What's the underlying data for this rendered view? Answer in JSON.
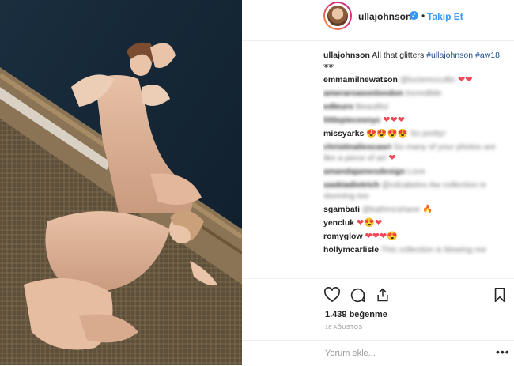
{
  "header": {
    "username": "ullajohnson",
    "verified_icon": "verified-badge-icon",
    "separator": "•",
    "follow_label": "Takip Et"
  },
  "caption": {
    "username": "ullajohnson",
    "text": "All that glitters",
    "hashtag1": "#ullajohnson",
    "hashtag2": "#aw18",
    "emoji": "🕶"
  },
  "comments": [
    {
      "user": "emmamilnewatson",
      "mention": "@luciemccullin",
      "text": "",
      "emoji": "❤❤"
    },
    {
      "user": "ameraroasonlondon",
      "mention": "",
      "text": "Incredible",
      "emoji": ""
    },
    {
      "user": "edleuro",
      "mention": "",
      "text": "Beautiful",
      "emoji": ""
    },
    {
      "user": "littlepiecesnyc",
      "mention": "",
      "text": "",
      "emoji": "❤❤❤"
    },
    {
      "user": "missyarks",
      "mention": "",
      "text": "So pretty!",
      "emoji": "😍😍😍😍"
    },
    {
      "user": "christinaliescasri",
      "mention": "",
      "text": "So many of your photos are like a piece of art",
      "emoji": "❤"
    },
    {
      "user": "amandajamesdesign",
      "mention": "",
      "text": "Love",
      "emoji": ""
    },
    {
      "user": "saskiadiotrich",
      "mention": "@cdcabelvo",
      "text": "Aw collection is stunning too",
      "emoji": ""
    },
    {
      "user": "sgambati",
      "mention": "@kathmcshane",
      "text": "",
      "emoji": "🔥"
    },
    {
      "user": "yencluk",
      "mention": "",
      "text": "",
      "emoji": "❤😍❤"
    },
    {
      "user": "romyglow",
      "mention": "",
      "text": "",
      "emoji": "❤❤❤😍"
    },
    {
      "user": "hollymcarlisle",
      "mention": "",
      "text": "This collection is blowing me",
      "emoji": ""
    }
  ],
  "actions": {
    "like_icon": "heart-icon",
    "comment_icon": "comment-icon",
    "share_icon": "share-icon",
    "save_icon": "bookmark-icon"
  },
  "likes": "1.439 beğenme",
  "date": "18 AĞUSTOS",
  "add_comment": {
    "placeholder": "Yorum ekle...",
    "more_label": "•••"
  },
  "colors": {
    "link": "#3897f0",
    "heart": "#ed4956",
    "hashtag": "#1f4f8a"
  }
}
